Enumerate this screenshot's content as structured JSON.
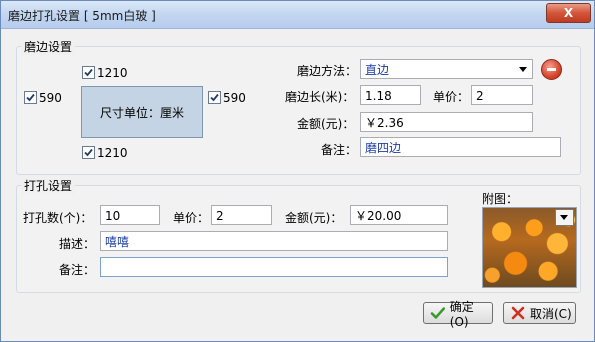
{
  "window": {
    "title": "磨边打孔设置 [ 5mm白玻 ]",
    "close_label": "X"
  },
  "edging": {
    "group_label": "磨边设置",
    "checkbox_top": "1210",
    "checkbox_bottom": "1210",
    "checkbox_left": "590",
    "checkbox_right": "590",
    "unit_text": "尺寸单位：厘米",
    "method_label": "磨边方法：",
    "method_value": "直边",
    "length_label": "磨边长(米)：",
    "length_value": "1.18",
    "price_label": "单价：",
    "price_value": "2",
    "amount_label": "金额(元)：",
    "amount_value": "￥2.36",
    "note_label": "备注：",
    "note_value": "磨四边"
  },
  "drilling": {
    "group_label": "打孔设置",
    "count_label": "打孔数(个)：",
    "count_value": "10",
    "price_label": "单价：",
    "price_value": "2",
    "amount_label": "金额(元)：",
    "amount_value": "￥20.00",
    "desc_label": "描述：",
    "desc_value": "嘻嘻",
    "note_label": "备注：",
    "note_value": "",
    "image_label": "附图："
  },
  "buttons": {
    "ok_label": "确定(O)",
    "cancel_label": "取消(C)"
  }
}
